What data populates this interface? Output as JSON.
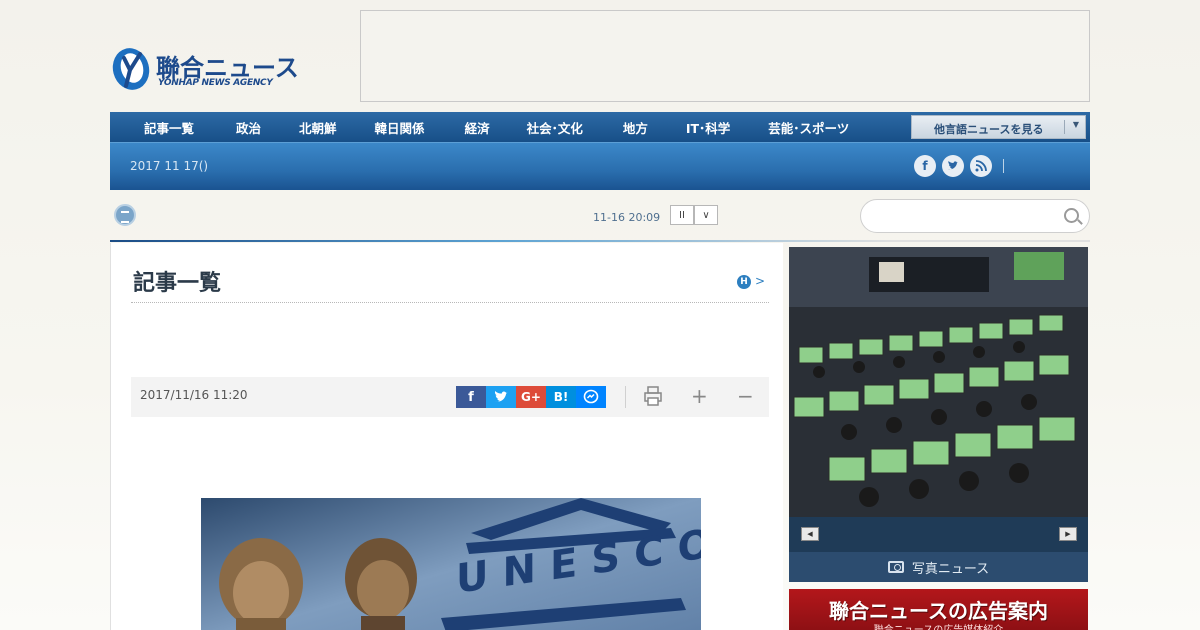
{
  "header": {
    "logo_jp": "聯合ニュース",
    "logo_en": "YONHAP NEWS AGENCY"
  },
  "nav": {
    "items": [
      "記事一覧",
      "政治",
      "北朝鮮",
      "韓日関係",
      "経済",
      "社会･文化",
      "地方",
      "IT･科学",
      "芸能･スポーツ"
    ],
    "language_select": "他言語ニュースを見る"
  },
  "subbar": {
    "date": "2017 11 17()",
    "social_icons": [
      "facebook-icon",
      "twitter-icon",
      "rss-icon"
    ]
  },
  "ticker": {
    "time": "11-16 20:09",
    "pause_label": "II",
    "down_label": "∨"
  },
  "search": {
    "placeholder": ""
  },
  "article": {
    "section_title": "記事一覧",
    "badge": "H",
    "badge_arrow": ">",
    "date": "2017/11/16 11:20",
    "share": {
      "facebook": "f",
      "twitter": "t",
      "google": "G+",
      "hatena": "B!",
      "messenger": "m"
    },
    "zoom_in": "+",
    "zoom_out": "−",
    "photo_text": "UNESCO"
  },
  "sidebar": {
    "photo_prev": "◀",
    "photo_next": "▶",
    "photo_caption": "写真ニュース",
    "ad_title": "聯合ニュースの広告案内",
    "ad_subtitle": "聯合ニュースの広告媒体紹介"
  },
  "colors": {
    "brand_blue": "#1d4a8c",
    "nav_blue": "#174f88",
    "ad_red": "#b3171b"
  }
}
